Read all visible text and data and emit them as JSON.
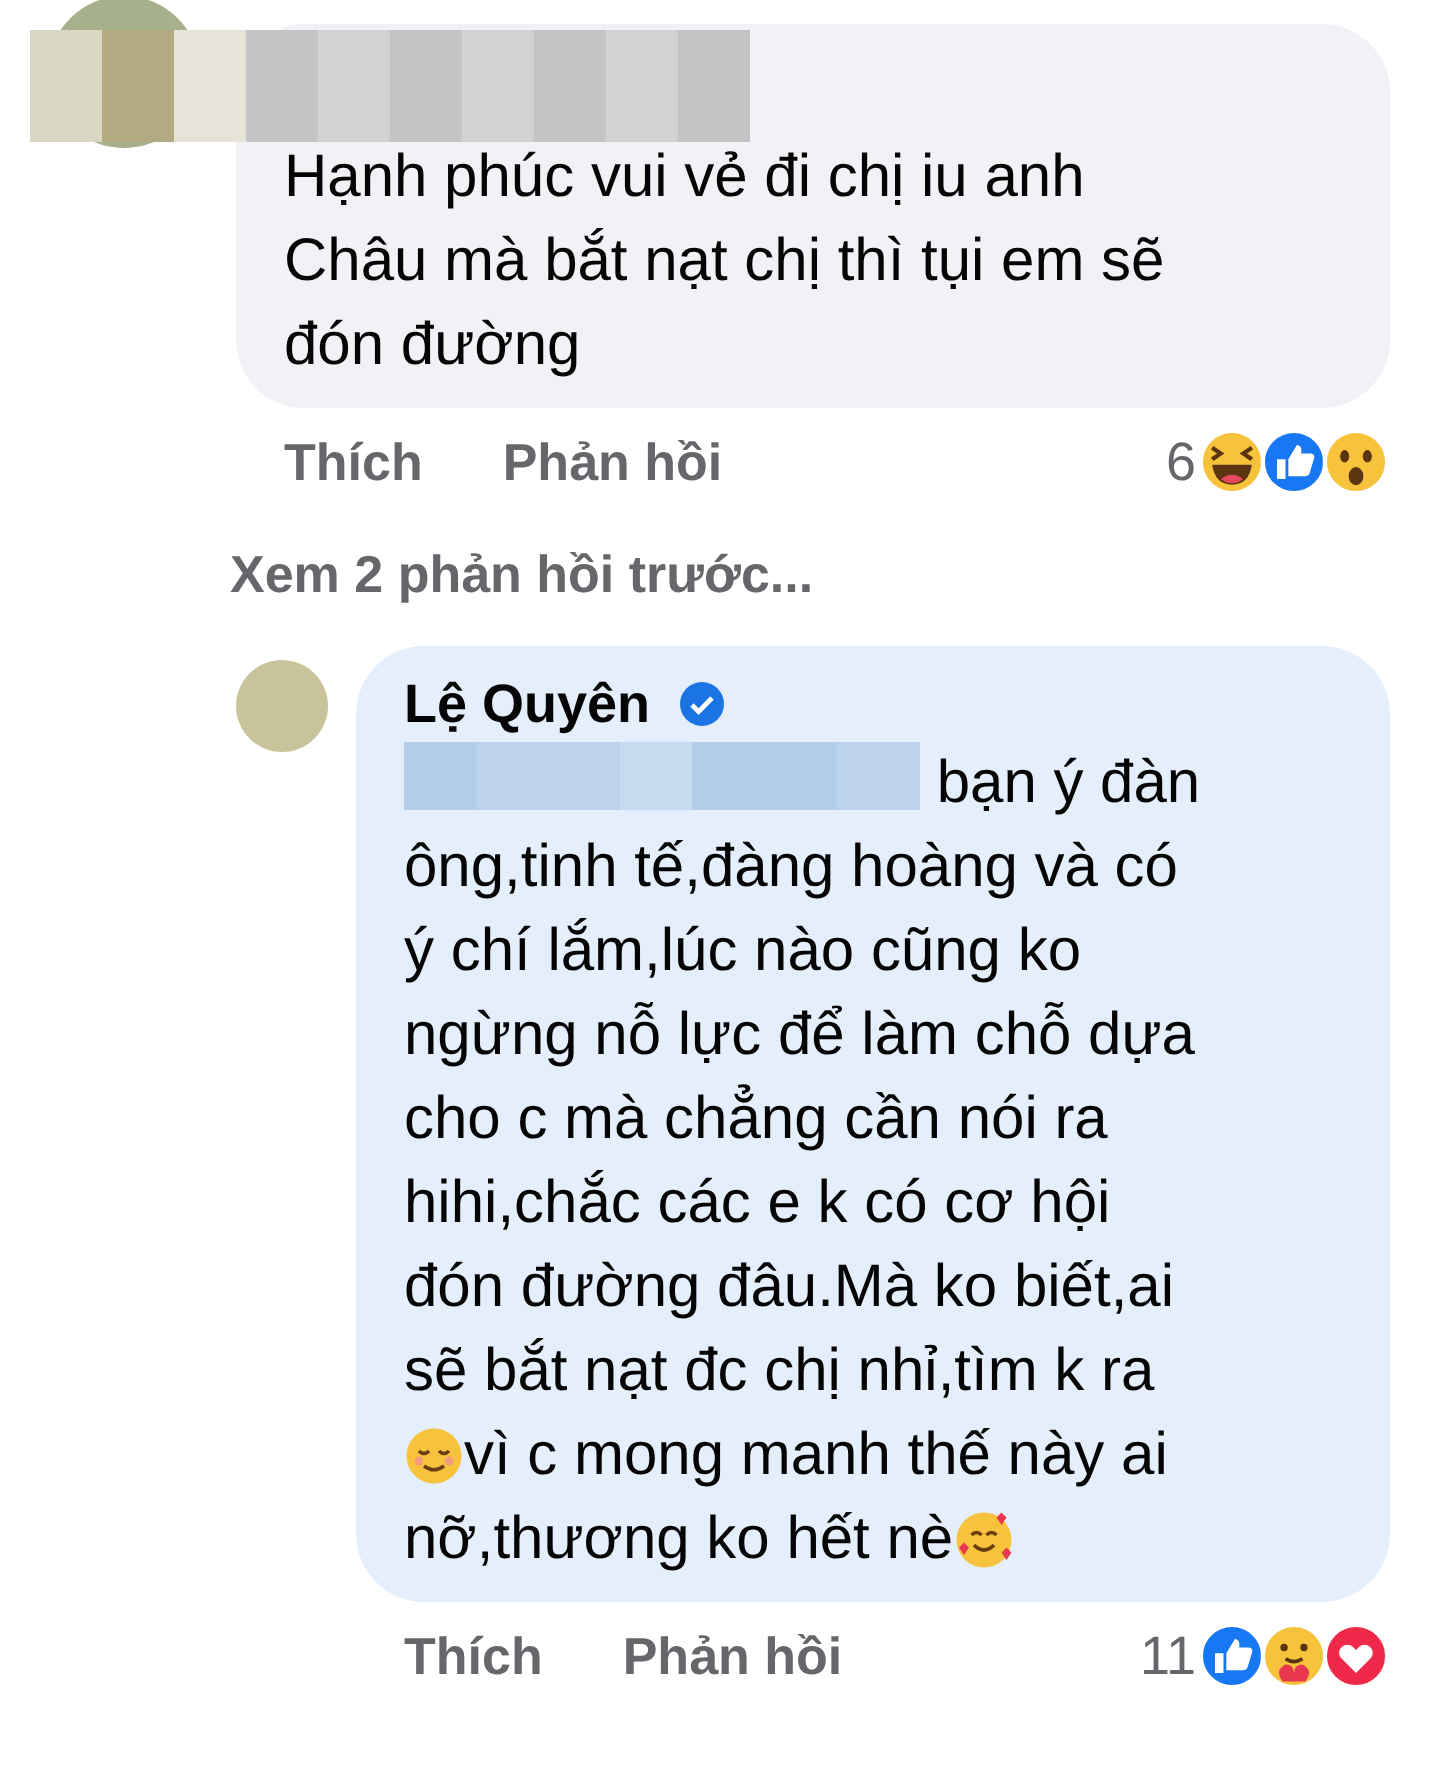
{
  "comments": [
    {
      "author_redacted": true,
      "segments": [
        {
          "kind": "text",
          "text": "Hạnh phúc vui vẻ đi chị iu anh\nChâu mà bắt nạt chị thì tụi em sẽ\nđón đường"
        }
      ],
      "actions": [
        "Thích",
        "Phản hồi"
      ],
      "reaction_count": "6",
      "reactions": [
        {
          "kind": "haha"
        },
        {
          "kind": "like"
        },
        {
          "kind": "wow"
        }
      ]
    }
  ],
  "more_replies": "Xem 2 phản hồi trước...",
  "replies": [
    {
      "author": "Lệ Quyên",
      "verified": true,
      "segments": [
        {
          "kind": "redacted"
        },
        {
          "kind": "text",
          "text": " bạn ý đàn\nông,tinh tế,đàng hoàng và có\ný chí lắm,lúc nào cũng ko\nngừng nỗ lực để làm chỗ dựa\ncho c mà chẳng cần nói ra\nhihi,chắc các e k có cơ hội\nđón đường đâu.Mà ko biết,ai\nsẽ bắt nạt đc chị nhỉ,tìm k ra\n"
        },
        {
          "kind": "relieved"
        },
        {
          "kind": "text",
          "text": "vì c mong manh thế này ai\nnỡ,thương ko hết nè"
        },
        {
          "kind": "hearts"
        }
      ],
      "actions": [
        "Thích",
        "Phản hồi"
      ],
      "reaction_count": "11",
      "reactions": [
        {
          "kind": "like"
        },
        {
          "kind": "care"
        },
        {
          "kind": "love"
        }
      ]
    }
  ]
}
